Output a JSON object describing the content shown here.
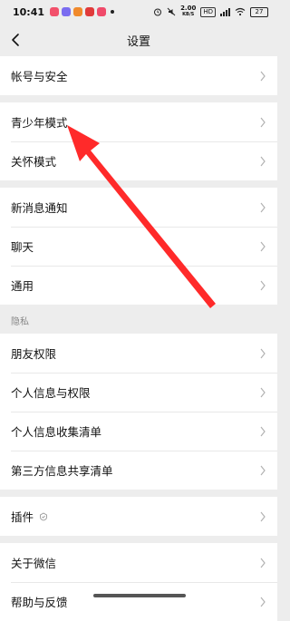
{
  "status_bar": {
    "time": "10:41",
    "net_speed_value": "2.00",
    "net_speed_unit": "KB/S",
    "hd_label": "HD",
    "wifi_label": "5G",
    "battery": "27",
    "app_icon_colors": [
      "#f2506b",
      "#7a6cf0",
      "#f08a2c",
      "#e03a3a",
      "#f04a6a"
    ]
  },
  "nav": {
    "title": "设置"
  },
  "groups": [
    {
      "items": [
        {
          "label": "帐号与安全"
        }
      ]
    },
    {
      "items": [
        {
          "label": "青少年模式"
        },
        {
          "label": "关怀模式"
        }
      ]
    },
    {
      "items": [
        {
          "label": "新消息通知"
        },
        {
          "label": "聊天"
        },
        {
          "label": "通用"
        }
      ]
    },
    {
      "header": "隐私",
      "items": [
        {
          "label": "朋友权限"
        },
        {
          "label": "个人信息与权限"
        },
        {
          "label": "个人信息收集清单"
        },
        {
          "label": "第三方信息共享清单"
        }
      ]
    },
    {
      "items": [
        {
          "label": "插件"
        }
      ]
    },
    {
      "items": [
        {
          "label": "关于微信"
        },
        {
          "label": "帮助与反馈"
        }
      ]
    }
  ],
  "colors": {
    "annotation_arrow": "#ff2a2a",
    "background": "#ededed"
  }
}
